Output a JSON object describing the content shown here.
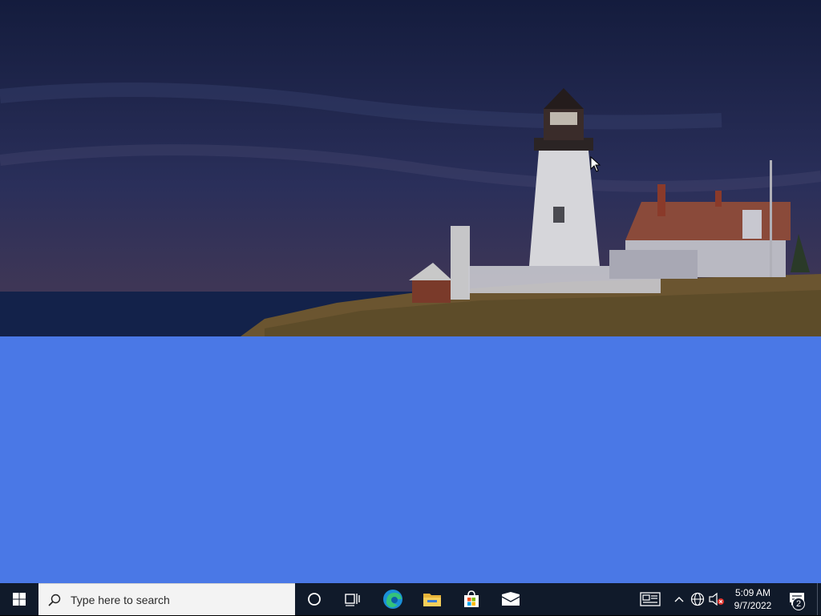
{
  "search": {
    "placeholder": "Type here to search"
  },
  "tray": {
    "time": "5:09 AM",
    "date": "9/7/2022",
    "notification_count": "2"
  },
  "colors": {
    "taskbar": "#101a2a",
    "desktop_blue": "#4a78e6",
    "search_bg": "#f3f3f3"
  },
  "icons": [
    "windows-logo-icon",
    "search-icon",
    "cortana-icon",
    "task-view-icon",
    "edge-icon",
    "file-explorer-icon",
    "store-icon",
    "mail-icon",
    "news-icon",
    "chevron-up-icon",
    "network-icon",
    "volume-muted-icon",
    "notification-icon"
  ]
}
